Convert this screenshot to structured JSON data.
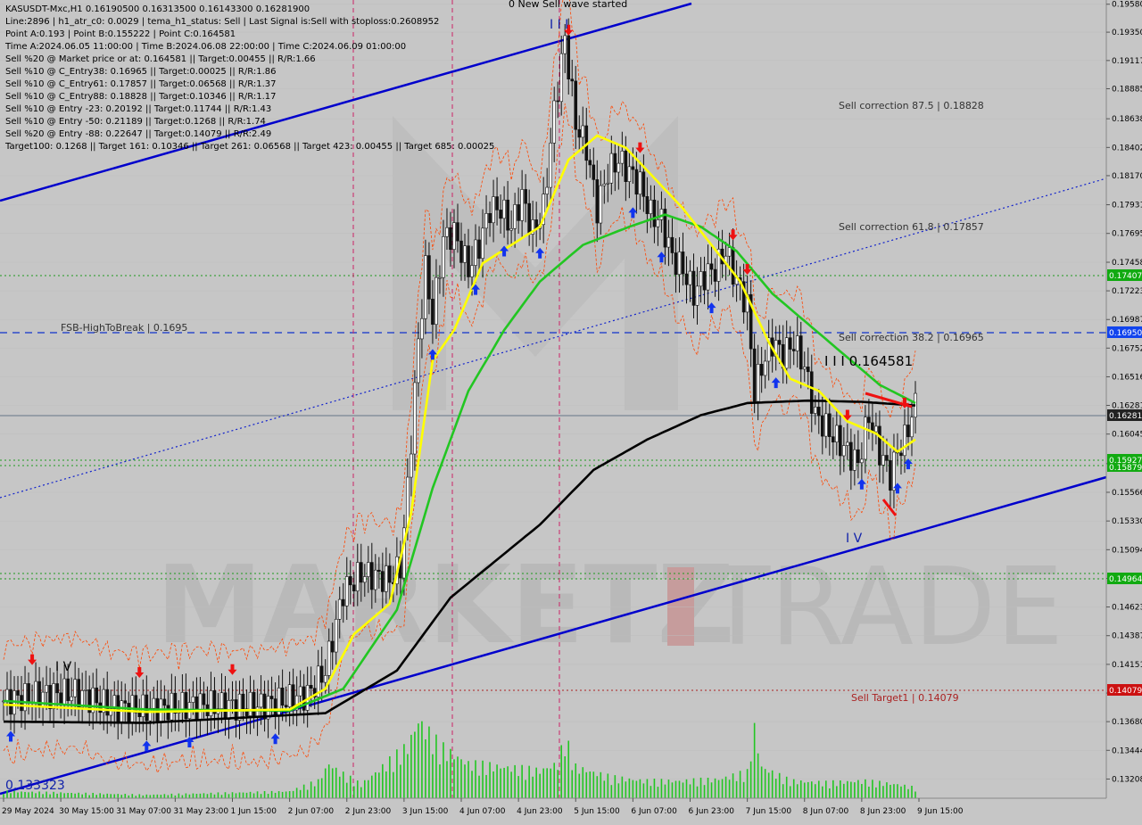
{
  "colors": {
    "background": "#c6c6c6",
    "grid": "#aaaaaa",
    "green_line": "#22c622",
    "black_line": "#000000",
    "yellow_line": "#ffff00",
    "channel": "#0000cc",
    "orange_band": "#ff4500",
    "volume": "#22c622",
    "tag_green": "#11aa11",
    "tag_blue": "#1144ee",
    "tag_gray": "#222222",
    "tag_red": "#cc1111",
    "watermark": "#b5b5b5",
    "watermark_red": "#c77b7b"
  },
  "header": {
    "lines": [
      "KASUSDT-Mxc,H1  0.16190500 0.16313500 0.16143300 0.16281900",
      "Line:2896 | h1_atr_c0: 0.0029 | tema_h1_status: Sell | Last Signal is:Sell with stoploss:0.2608952",
      "Point A:0.193 | Point B:0.155222 | Point C:0.164581",
      "Time A:2024.06.05 11:00:00 | Time B:2024.06.08 22:00:00 | Time C:2024.06.09 01:00:00",
      "Sell %20 @ Market price or at: 0.164581 || Target:0.00455 || R/R:1.66",
      "Sell %10 @ C_Entry38: 0.16965 || Target:0.00025 || R/R:1.86",
      "Sell %10 @ C_Entry61: 0.17857 || Target:0.06568 || R/R:1.37",
      "Sell %10 @ C_Entry88: 0.18828 || Target:0.10346 || R/R:1.17",
      "Sell %10 @ Entry -23: 0.20192 || Target:0.11744 || R/R:1.43",
      "Sell %10 @ Entry -50: 0.21189 || Target:0.1268 || R/R:1.74",
      "Sell %20 @ Entry -88: 0.22647 || Target:0.14079 || R/R:2.49",
      "Target100: 0.1268 || Target 161: 0.10346 || Target 261: 0.06568 || Target 423: 0.00455 || Target 685: 0.00025"
    ]
  },
  "annotations": {
    "top_wave": "0 New Sell wave started",
    "wave_iii": "I I I",
    "wave_iv_left": "I V",
    "wave_iv_right": "I V",
    "point_c": "I I I 0.164581",
    "low_value": "0.133323",
    "fsb": "FSB-HighToBreak | 0.1695",
    "sell_corr_875": "Sell correction 87.5 | 0.18828",
    "sell_corr_618": "Sell correction 61.8 | 0.17857",
    "sell_corr_382": "Sell correction 38.2 | 0.16965",
    "sell_target1": "Sell Target1 | 0.14079"
  },
  "watermark": {
    "left": "MARKETZ",
    "mid": "I",
    "right": "TRADE"
  },
  "price_tags": {
    "t17407": "0.17407",
    "t16950": "0.16950",
    "t16281": "0.16281",
    "t15927": "0.15927",
    "t15879": "0.15879",
    "t14964": "0.14964",
    "t14079": "0.14079"
  },
  "chart_data": {
    "type": "candlestick",
    "symbol": "KASUSDT-Mxc",
    "timeframe": "H1",
    "ylim": [
      0.1305,
      0.196
    ],
    "y_ticks": [
      "0.19580",
      "0.19350",
      "0.19117",
      "0.18885",
      "0.18638",
      "0.18402",
      "0.18170",
      "0.17931",
      "0.17695",
      "0.17458",
      "0.17223",
      "0.16987",
      "0.16752",
      "0.16516",
      "0.16281",
      "0.16045",
      "0.15802",
      "0.15566",
      "0.15330",
      "0.15094",
      "0.14858",
      "0.14623",
      "0.14387",
      "0.14151",
      "0.13915",
      "0.13680",
      "0.13444",
      "0.13208"
    ],
    "x_ticks": [
      "29 May 2024",
      "30 May 15:00",
      "31 May 07:00",
      "31 May 23:00",
      "1 Jun 15:00",
      "2 Jun 07:00",
      "2 Jun 23:00",
      "3 Jun 15:00",
      "4 Jun 07:00",
      "4 Jun 23:00",
      "5 Jun 15:00",
      "6 Jun 07:00",
      "6 Jun 23:00",
      "7 Jun 15:00",
      "8 Jun 07:00",
      "8 Jun 23:00",
      "9 Jun 15:00"
    ],
    "x_index": [
      0,
      16,
      32,
      48,
      64,
      80,
      96,
      112,
      128,
      144,
      160,
      176,
      192,
      208,
      224,
      240,
      256
    ],
    "bars_count": 256,
    "price_path": [
      [
        0,
        0.1385
      ],
      [
        10,
        0.139
      ],
      [
        20,
        0.1392
      ],
      [
        30,
        0.138
      ],
      [
        40,
        0.1378
      ],
      [
        55,
        0.1382
      ],
      [
        70,
        0.138
      ],
      [
        85,
        0.139
      ],
      [
        90,
        0.141
      ],
      [
        95,
        0.1475
      ],
      [
        100,
        0.149
      ],
      [
        108,
        0.1485
      ],
      [
        111,
        0.1495
      ],
      [
        113,
        0.156
      ],
      [
        116,
        0.168
      ],
      [
        118,
        0.174
      ],
      [
        120,
        0.17
      ],
      [
        123,
        0.1765
      ],
      [
        126,
        0.177
      ],
      [
        130,
        0.174
      ],
      [
        133,
        0.176
      ],
      [
        136,
        0.179
      ],
      [
        139,
        0.179
      ],
      [
        142,
        0.1775
      ],
      [
        145,
        0.18
      ],
      [
        148,
        0.177
      ],
      [
        151,
        0.179
      ],
      [
        154,
        0.187
      ],
      [
        157,
        0.193
      ],
      [
        160,
        0.186
      ],
      [
        163,
        0.184
      ],
      [
        166,
        0.179
      ],
      [
        169,
        0.182
      ],
      [
        172,
        0.183
      ],
      [
        175,
        0.182
      ],
      [
        178,
        0.181
      ],
      [
        181,
        0.1785
      ],
      [
        184,
        0.178
      ],
      [
        187,
        0.175
      ],
      [
        190,
        0.174
      ],
      [
        193,
        0.172
      ],
      [
        196,
        0.1735
      ],
      [
        199,
        0.174
      ],
      [
        202,
        0.1755
      ],
      [
        205,
        0.173
      ],
      [
        208,
        0.171
      ],
      [
        210,
        0.164
      ],
      [
        212,
        0.166
      ],
      [
        215,
        0.168
      ],
      [
        218,
        0.167
      ],
      [
        221,
        0.168
      ],
      [
        224,
        0.166
      ],
      [
        227,
        0.162
      ],
      [
        230,
        0.161
      ],
      [
        233,
        0.16
      ],
      [
        236,
        0.159
      ],
      [
        239,
        0.158
      ],
      [
        242,
        0.162
      ],
      [
        245,
        0.159
      ],
      [
        248,
        0.157
      ],
      [
        250,
        0.159
      ],
      [
        252,
        0.16
      ],
      [
        254,
        0.162
      ],
      [
        255,
        0.1628
      ]
    ],
    "lines": [
      {
        "name": "MA200",
        "color": "#000000",
        "points": [
          [
            0,
            0.1368
          ],
          [
            40,
            0.1367
          ],
          [
            90,
            0.1375
          ],
          [
            110,
            0.141
          ],
          [
            125,
            0.147
          ],
          [
            150,
            0.153
          ],
          [
            165,
            0.1575
          ],
          [
            180,
            0.16
          ],
          [
            195,
            0.162
          ],
          [
            208,
            0.163
          ],
          [
            225,
            0.1632
          ],
          [
            240,
            0.1631
          ],
          [
            255,
            0.1628
          ]
        ]
      },
      {
        "name": "MA50",
        "color": "#22c622",
        "points": [
          [
            0,
            0.1385
          ],
          [
            40,
            0.1378
          ],
          [
            80,
            0.1377
          ],
          [
            95,
            0.1395
          ],
          [
            110,
            0.146
          ],
          [
            120,
            0.156
          ],
          [
            130,
            0.164
          ],
          [
            140,
            0.169
          ],
          [
            150,
            0.173
          ],
          [
            162,
            0.176
          ],
          [
            175,
            0.1775
          ],
          [
            185,
            0.1785
          ],
          [
            195,
            0.1775
          ],
          [
            205,
            0.1755
          ],
          [
            215,
            0.172
          ],
          [
            225,
            0.1695
          ],
          [
            235,
            0.167
          ],
          [
            245,
            0.1645
          ],
          [
            255,
            0.163
          ]
        ]
      },
      {
        "name": "MA20",
        "color": "#ffff00",
        "points": [
          [
            0,
            0.1382
          ],
          [
            40,
            0.1376
          ],
          [
            80,
            0.1378
          ],
          [
            90,
            0.1395
          ],
          [
            98,
            0.144
          ],
          [
            108,
            0.1465
          ],
          [
            114,
            0.154
          ],
          [
            120,
            0.1665
          ],
          [
            126,
            0.169
          ],
          [
            134,
            0.1745
          ],
          [
            142,
            0.176
          ],
          [
            150,
            0.1775
          ],
          [
            158,
            0.183
          ],
          [
            166,
            0.185
          ],
          [
            174,
            0.184
          ],
          [
            182,
            0.1815
          ],
          [
            190,
            0.179
          ],
          [
            198,
            0.176
          ],
          [
            206,
            0.173
          ],
          [
            214,
            0.168
          ],
          [
            220,
            0.165
          ],
          [
            228,
            0.164
          ],
          [
            236,
            0.1615
          ],
          [
            244,
            0.1605
          ],
          [
            250,
            0.159
          ],
          [
            255,
            0.16
          ]
        ]
      }
    ],
    "volume": [
      [
        0,
        0.004
      ],
      [
        20,
        0.003
      ],
      [
        40,
        0.002
      ],
      [
        60,
        0.003
      ],
      [
        80,
        0.004
      ],
      [
        88,
        0.01
      ],
      [
        91,
        0.02
      ],
      [
        94,
        0.015
      ],
      [
        100,
        0.008
      ],
      [
        113,
        0.03
      ],
      [
        116,
        0.045
      ],
      [
        118,
        0.04
      ],
      [
        122,
        0.03
      ],
      [
        126,
        0.025
      ],
      [
        130,
        0.02
      ],
      [
        140,
        0.018
      ],
      [
        150,
        0.016
      ],
      [
        155,
        0.02
      ],
      [
        157,
        0.035
      ],
      [
        160,
        0.018
      ],
      [
        170,
        0.012
      ],
      [
        180,
        0.01
      ],
      [
        190,
        0.01
      ],
      [
        200,
        0.011
      ],
      [
        208,
        0.015
      ],
      [
        210,
        0.04
      ],
      [
        212,
        0.018
      ],
      [
        220,
        0.01
      ],
      [
        230,
        0.009
      ],
      [
        240,
        0.01
      ],
      [
        250,
        0.008
      ],
      [
        255,
        0.006
      ]
    ]
  }
}
